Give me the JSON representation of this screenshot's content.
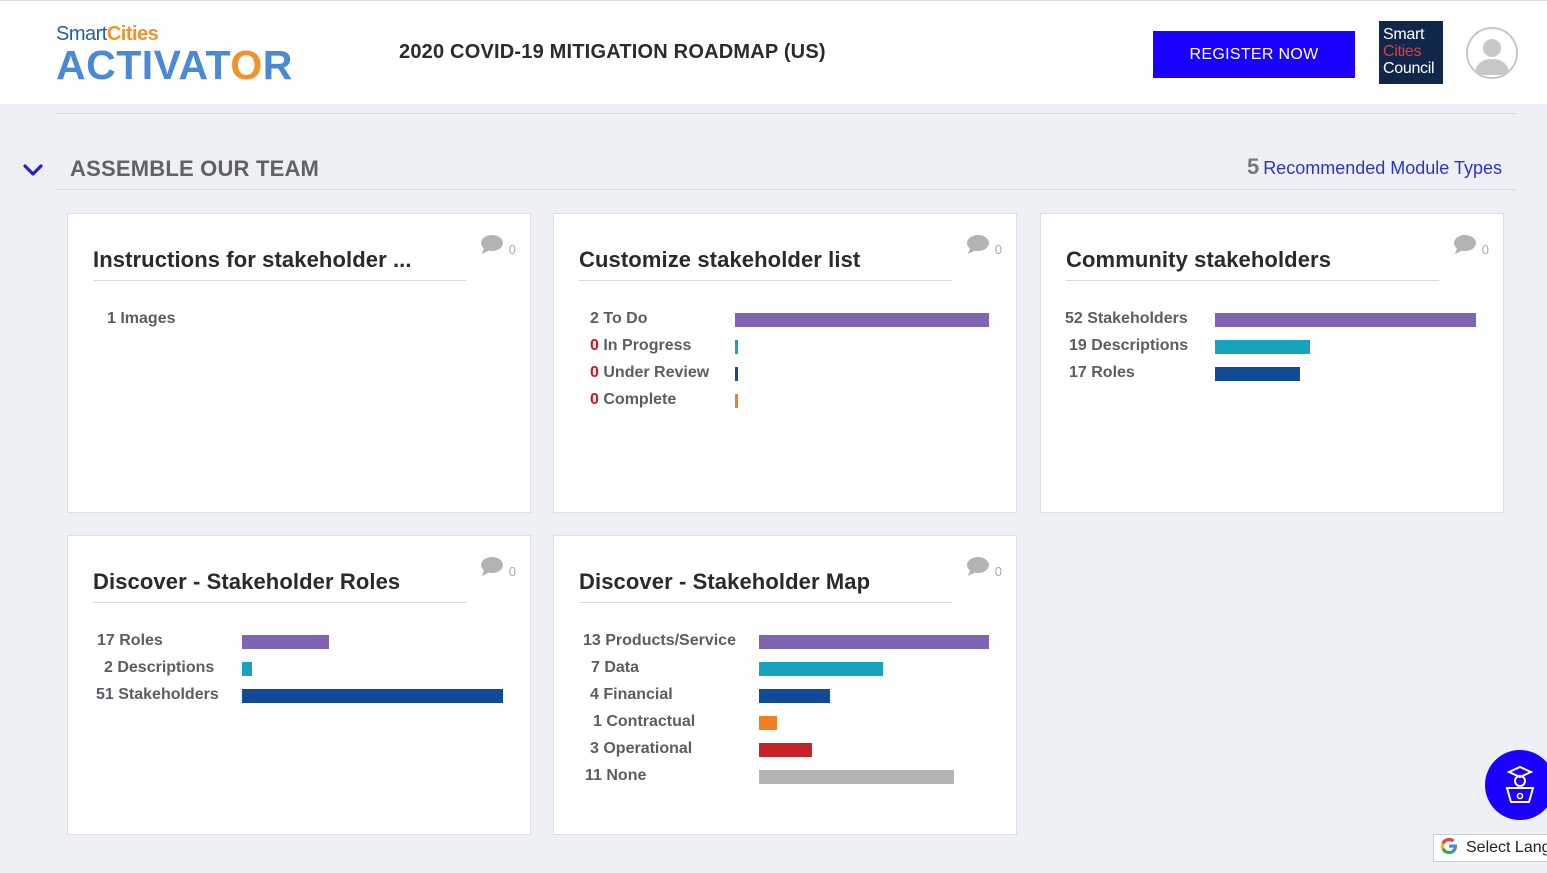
{
  "header": {
    "logo_top_smart": "Smart",
    "logo_top_cities": "Cities",
    "logo_main_left": "ACTIVAT",
    "logo_main_o": "O",
    "logo_main_right": "R",
    "roadmap_title": "2020 COVID-19 MITIGATION ROADMAP (US)",
    "register_label": "REGISTER NOW",
    "council_line1": "Smart",
    "council_line2": "Cities",
    "council_line3": "Council"
  },
  "section": {
    "title": "ASSEMBLE OUR TEAM",
    "module_count": "5",
    "module_label": "Recommended Module Types"
  },
  "cards": [
    {
      "title": "Instructions for stakeholder ...",
      "comments": "0",
      "stats": [
        {
          "label": "1 Images"
        }
      ]
    },
    {
      "title": "Customize stakeholder list",
      "comments": "0",
      "stats": [
        {
          "count": "2",
          "label": "To Do",
          "value": 2,
          "color": "#8064b2"
        },
        {
          "count": "0",
          "label": "In Progress",
          "value": 0,
          "color": "#17a2bf"
        },
        {
          "count": "0",
          "label": "Under Review",
          "value": 0,
          "color": "#134a97"
        },
        {
          "count": "0",
          "label": "Complete",
          "value": 0,
          "color": "#f07f23"
        }
      ]
    },
    {
      "title": "Community stakeholders",
      "comments": "0",
      "stats": [
        {
          "label": "52 Stakeholders",
          "value": 52,
          "color": "#8064b2"
        },
        {
          "label": "19 Descriptions",
          "value": 19,
          "color": "#17a2bf"
        },
        {
          "label": "17 Roles",
          "value": 17,
          "color": "#134a97"
        }
      ]
    },
    {
      "title": "Discover - Stakeholder Roles",
      "comments": "0",
      "stats": [
        {
          "label": "17 Roles",
          "value": 17,
          "color": "#8064b2"
        },
        {
          "label": "2 Descriptions",
          "value": 2,
          "color": "#17a2bf"
        },
        {
          "label": "51 Stakeholders",
          "value": 51,
          "color": "#134a97"
        }
      ]
    },
    {
      "title": "Discover - Stakeholder Map",
      "comments": "0",
      "stats": [
        {
          "label": "13 Products/Service",
          "value": 13,
          "color": "#8064b2"
        },
        {
          "label": "7 Data",
          "value": 7,
          "color": "#17a2bf"
        },
        {
          "label": "4 Financial",
          "value": 4,
          "color": "#134a97"
        },
        {
          "label": "1 Contractual",
          "value": 1,
          "color": "#f07f23"
        },
        {
          "label": "3 Operational",
          "value": 3,
          "color": "#c4232a"
        },
        {
          "label": "11 None",
          "value": 11,
          "color": "#b4b4b4"
        }
      ]
    }
  ],
  "translate": {
    "label": "Select Language"
  },
  "icons": {
    "collapse": "chevron-down-icon",
    "comment": "comment-bubble-icon",
    "avatar": "user-avatar-icon",
    "help": "graduate-helper-icon",
    "google": "google-g-icon"
  }
}
